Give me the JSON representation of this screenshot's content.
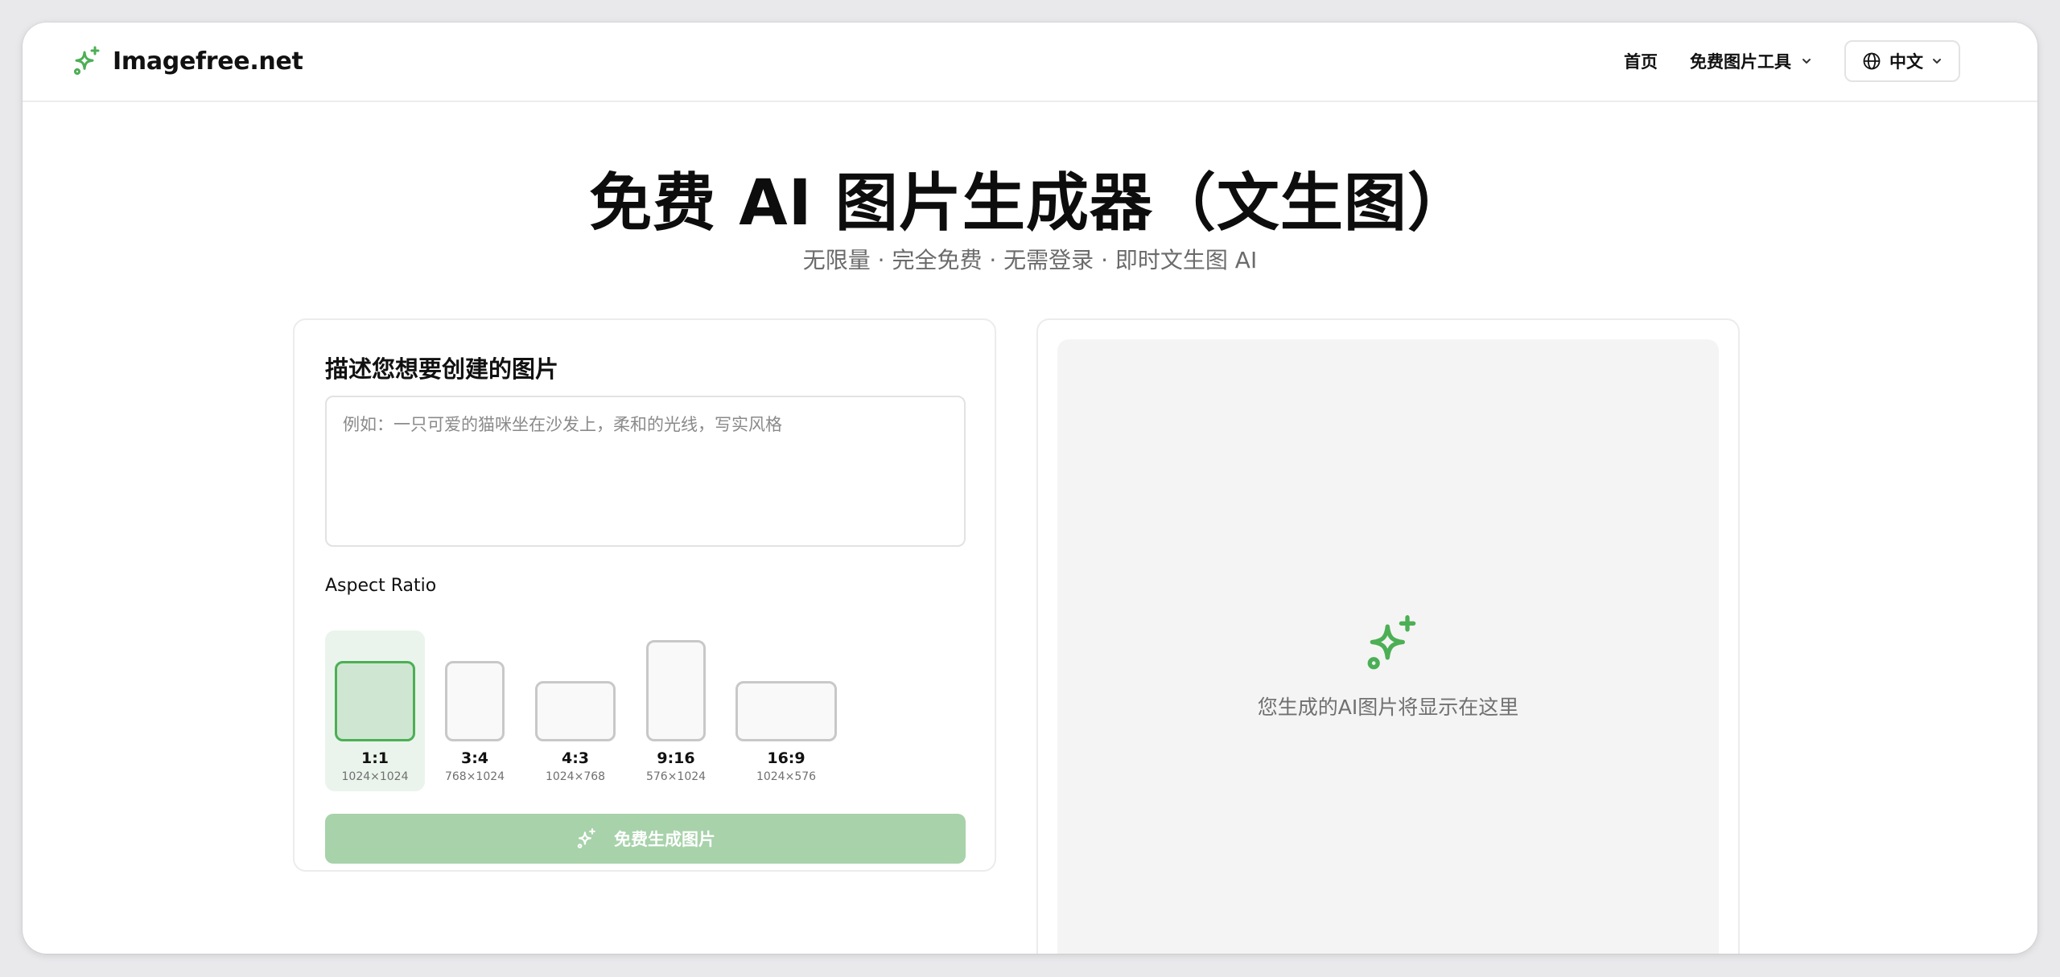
{
  "brand": {
    "name": "Imagefree.net",
    "icon": "sparkle-icon",
    "accent": "#4caf55"
  },
  "nav": {
    "home": "首页",
    "tools": "免费图片工具",
    "language": "中文"
  },
  "hero": {
    "title": "免费 AI 图片生成器（文生图）",
    "subtitle": "无限量 · 完全免费 · 无需登录 · 即时文生图 AI"
  },
  "form": {
    "section_title": "描述您想要创建的图片",
    "prompt_placeholder": "例如：一只可爱的猫咪坐在沙发上，柔和的光线，写实风格",
    "prompt_value": "",
    "aspect_label": "Aspect Ratio",
    "ratios": [
      {
        "name": "1:1",
        "size": "1024×1024",
        "selected": true
      },
      {
        "name": "3:4",
        "size": "768×1024",
        "selected": false
      },
      {
        "name": "4:3",
        "size": "1024×768",
        "selected": false
      },
      {
        "name": "9:16",
        "size": "576×1024",
        "selected": false
      },
      {
        "name": "16:9",
        "size": "1024×576",
        "selected": false
      }
    ],
    "generate_label": "免费生成图片"
  },
  "preview": {
    "placeholder_text": "您生成的AI图片将显示在这里"
  },
  "colors": {
    "accent": "#4caf55",
    "button_disabled": "#a7d2aa",
    "selected_bg": "#eaf4ec"
  }
}
